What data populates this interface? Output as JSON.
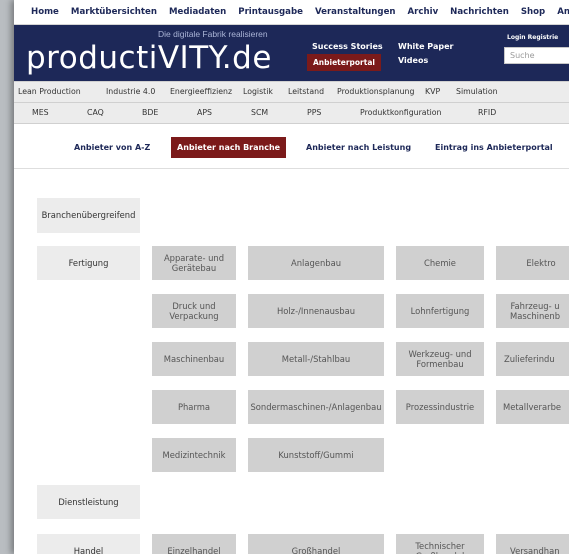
{
  "top_nav": [
    "Home",
    "Marktübersichten",
    "Mediadaten",
    "Printausgabe",
    "Veranstaltungen",
    "Archiv",
    "Nachrichten",
    "Shop",
    "Anbieterportal"
  ],
  "header": {
    "tagline": "Die digitale Fabrik realisieren",
    "logo": "productiVITY.de",
    "success_stories": "Success Stories",
    "anbieterportal": "Anbieterportal",
    "white_paper": "White Paper",
    "videos": "Videos",
    "login": "Login Registrie",
    "search_placeholder": "Suche"
  },
  "category_bar_1": [
    "Lean Production",
    "Industrie 4.0",
    "Energieeffizienz",
    "Logistik",
    "Leitstand",
    "Produktionsplanung",
    "KVP",
    "Simulation"
  ],
  "category_bar_2": [
    "MES",
    "CAQ",
    "BDE",
    "APS",
    "SCM",
    "PPS",
    "Produktkonfiguration",
    "RFID"
  ],
  "tabs": [
    "Anbieter von A-Z",
    "Anbieter nach Branche",
    "Anbieter nach Leistung",
    "Eintrag ins Anbieterportal"
  ],
  "active_tab": 1,
  "branches": [
    {
      "name": "Branchenübergreifend",
      "items": []
    },
    {
      "name": "Fertigung",
      "items": [
        "Apparate- und\nGerätebau",
        "Anlagenbau",
        "Chemie",
        "Elektro",
        "Druck und\nVerpackung",
        "Holz-/Innenausbau",
        "Lohnfertigung",
        "Fahrzeug- u\nMaschinenb",
        "Maschinenbau",
        "Metall-/Stahlbau",
        "Werkzeug- und\nFormenbau",
        "Zulieferindu",
        "Pharma",
        "Sondermaschinen-/Anlagenbau",
        "Prozessindustrie",
        "Metallverarbe",
        "Medizintechnik",
        "Kunststoff/Gummi"
      ]
    },
    {
      "name": "Dienstleistung",
      "items": []
    },
    {
      "name": "Handel",
      "items": [
        "Einzelhandel",
        "Großhandel",
        "Technischer\nGroßhandel",
        "Versandhan"
      ]
    }
  ],
  "colors": {
    "navy": "#1d2858",
    "maroon": "#7b1a1a",
    "cell_gray": "#d0d0d0",
    "row_head": "#ececec"
  }
}
